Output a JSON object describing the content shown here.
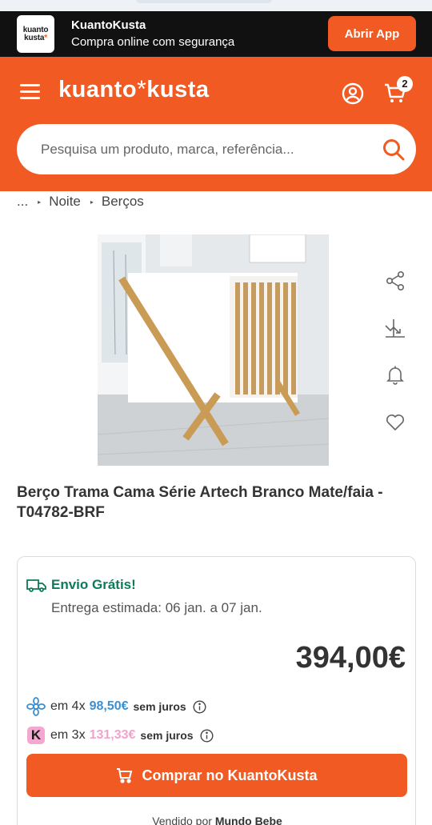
{
  "app_banner": {
    "logo_line1": "kuanto",
    "logo_line2": "kusta",
    "logo_star": "*",
    "name": "KuantoKusta",
    "subtitle": "Compra online com segurança",
    "open_app_label": "Abrir App"
  },
  "header": {
    "logo_part1": "kuanto",
    "logo_asterisk": "*",
    "logo_part2": "kusta",
    "cart_count": "2",
    "icons": [
      "menu-icon",
      "user-icon",
      "cart-icon"
    ]
  },
  "search": {
    "placeholder": "Pesquisa um produto, marca, referência..."
  },
  "breadcrumb": {
    "ellipsis": "...",
    "items": [
      "Noite",
      "Berços"
    ]
  },
  "product": {
    "title": "Berço Trama Cama Série Artech Branco Mate/faia - T04782-BRF",
    "side_icons": [
      "share-icon",
      "price-drop-icon",
      "alert-bell-icon",
      "heart-icon"
    ]
  },
  "offer": {
    "shipping_label": "Envio Grátis!",
    "delivery_text": "Entrega estimada: 06 jan. a 07 jan.",
    "price": "394,00€",
    "installments": [
      {
        "prefix": "em 4x",
        "amount": "98,50€",
        "suffix": "sem juros",
        "color": "#3d8fd1",
        "icon": "flower-icon"
      },
      {
        "prefix": "em 3x",
        "amount": "131,33€",
        "suffix": "sem juros",
        "color": "#f0a4cc",
        "icon": "klarna-icon",
        "icon_letter": "K"
      }
    ],
    "buy_label": "Comprar no KuantoKusta",
    "seller_prefix": "Vendido por",
    "seller_name": "Mundo Bebe"
  },
  "colors": {
    "brand_orange": "#f15a22",
    "banner_black": "#111111",
    "shipping_green": "#0d7a5a"
  }
}
